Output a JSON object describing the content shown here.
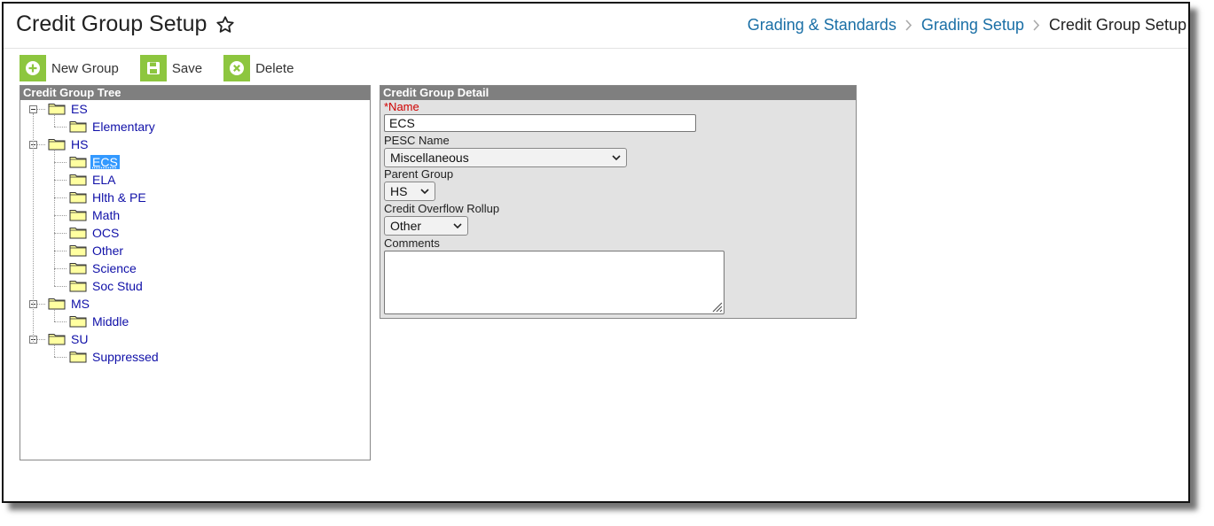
{
  "header": {
    "title": "Credit Group Setup",
    "breadcrumb": [
      "Grading & Standards",
      "Grading Setup",
      "Credit Group Setup"
    ]
  },
  "toolbar": {
    "new_group_label": "New Group",
    "save_label": "Save",
    "delete_label": "Delete"
  },
  "tree_panel": {
    "title": "Credit Group Tree",
    "nodes": [
      {
        "label": "ES",
        "level": 0,
        "expanded": true
      },
      {
        "label": "Elementary",
        "level": 1
      },
      {
        "label": "HS",
        "level": 0,
        "expanded": true
      },
      {
        "label": "ECS",
        "level": 1,
        "selected": true
      },
      {
        "label": "ELA",
        "level": 1
      },
      {
        "label": "Hlth & PE",
        "level": 1
      },
      {
        "label": "Math",
        "level": 1
      },
      {
        "label": "OCS",
        "level": 1
      },
      {
        "label": "Other",
        "level": 1
      },
      {
        "label": "Science",
        "level": 1
      },
      {
        "label": "Soc Stud",
        "level": 1
      },
      {
        "label": "MS",
        "level": 0,
        "expanded": true
      },
      {
        "label": "Middle",
        "level": 1
      },
      {
        "label": "SU",
        "level": 0,
        "expanded": true
      },
      {
        "label": "Suppressed",
        "level": 1
      }
    ]
  },
  "detail_panel": {
    "title": "Credit Group Detail",
    "name_label": "*Name",
    "name_value": "ECS",
    "pesc_label": "PESC Name",
    "pesc_value": "Miscellaneous",
    "parent_label": "Parent Group",
    "parent_value": "HS",
    "overflow_label": "Credit Overflow Rollup",
    "overflow_value": "Other",
    "comments_label": "Comments",
    "comments_value": ""
  },
  "colors": {
    "accent_green": "#8dc63f",
    "link_blue": "#1a6fa6",
    "tree_link": "#1010a8",
    "selected_bg": "#3399ff",
    "panel_header": "#7f7f7f",
    "required_red": "#d00000"
  }
}
